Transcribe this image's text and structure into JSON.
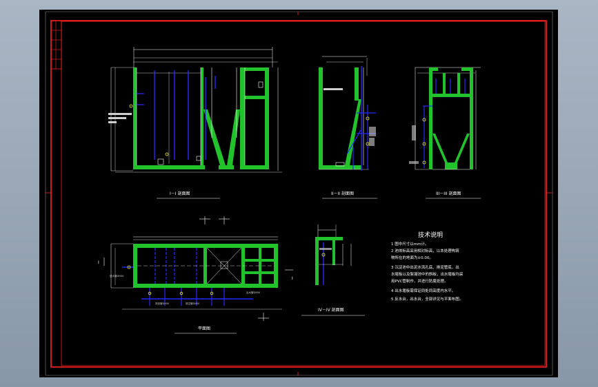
{
  "colors": {
    "background": "#000000",
    "frame": "#ff2020",
    "wall": "#22c22c",
    "pipe": "#2828ff",
    "line": "#ffffff"
  },
  "section_titles": {
    "s1": "I－I 剖面图",
    "s2": "II－II 剖面图",
    "s3": "III－III 剖面图",
    "s4": "IV－IV 剖面图",
    "plan": "平面图"
  },
  "plan_cut_markers": {
    "left": "I",
    "right": "I"
  },
  "tech_notes": {
    "title": "技术说明",
    "lines": [
      "1 图中尺寸以mm计。",
      "2 池体标高采用相对标高，以本处理构筑",
      "物所在的地面为±0.00。",
      "3 沉淀池中出泥水流孔底、排泥管底，出",
      "水堰板以及絮凝池中的斜板，出水堰板均采",
      "用PVC管制作，并进行防腐处理。",
      "4 出水堰板需保证同处同高度内水平。",
      "5 反水台，出水台，全部详见与平面布图。"
    ]
  },
  "pipe_labels": {
    "inlet": "进水管DN50",
    "sludge": "排泥管DN50",
    "drain": "放空管DN50",
    "outlet": "出水管DN50"
  }
}
